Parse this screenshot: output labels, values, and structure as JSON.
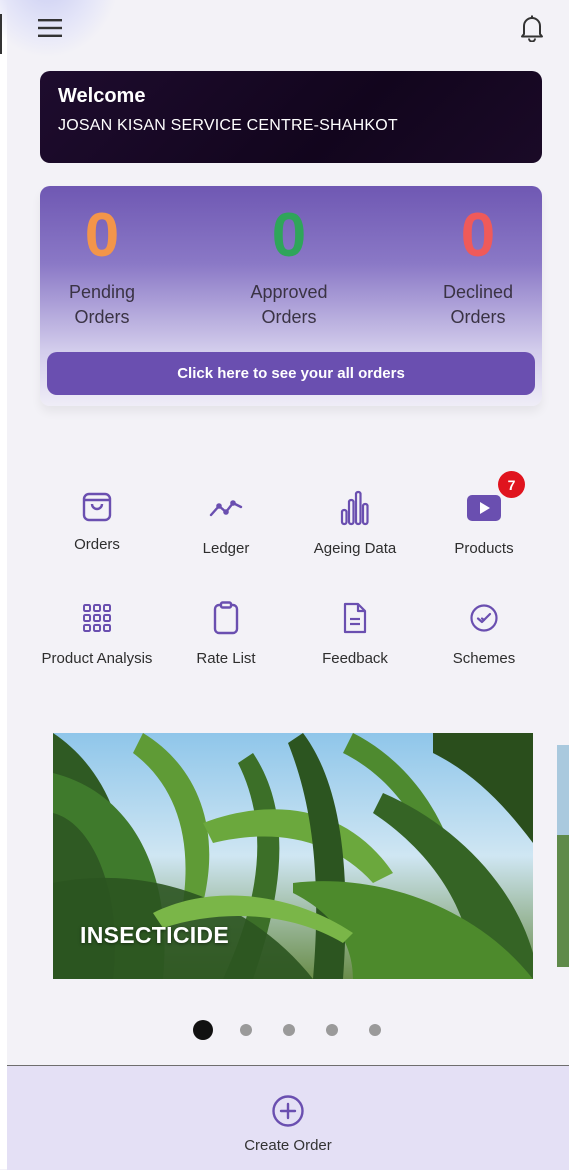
{
  "header": {
    "menu_icon": "hamburger-menu-icon",
    "bell_icon": "bell-icon"
  },
  "welcome": {
    "title": "Welcome",
    "name": "JOSAN KISAN SERVICE CENTRE-SHAHKOT"
  },
  "orders": {
    "pending": {
      "value": "0",
      "label_line1": "Pending",
      "label_line2": "Orders",
      "color": "#f3954a"
    },
    "approved": {
      "value": "0",
      "label_line1": "Approved",
      "label_line2": "Orders",
      "color": "#2fa55a"
    },
    "declined": {
      "value": "0",
      "label_line1": "Declined",
      "label_line2": "Orders",
      "color": "#ef5a5a"
    },
    "all_orders_button": "Click here to see your all orders"
  },
  "quick_links": [
    {
      "label": "Orders",
      "icon": "shopping-bag-icon"
    },
    {
      "label": "Ledger",
      "icon": "trend-line-icon"
    },
    {
      "label": "Ageing Data",
      "icon": "bar-chart-icon"
    },
    {
      "label": "Products",
      "icon": "video-play-icon",
      "badge": "7"
    },
    {
      "label": "Product Analysis",
      "icon": "grid-dots-icon"
    },
    {
      "label": "Rate List",
      "icon": "clipboard-icon"
    },
    {
      "label": "Feedback",
      "icon": "document-icon"
    },
    {
      "label": "Schemes",
      "icon": "verified-badge-icon"
    }
  ],
  "banner": {
    "title": "INSECTICIDE",
    "slide_count": 5,
    "active_slide": 1
  },
  "bottom_nav": {
    "create_order_label": "Create Order",
    "create_order_icon": "plus-circle-icon"
  },
  "colors": {
    "accent": "#6a4fb0",
    "icon": "#6a4fb0",
    "badge": "#e0141e"
  }
}
